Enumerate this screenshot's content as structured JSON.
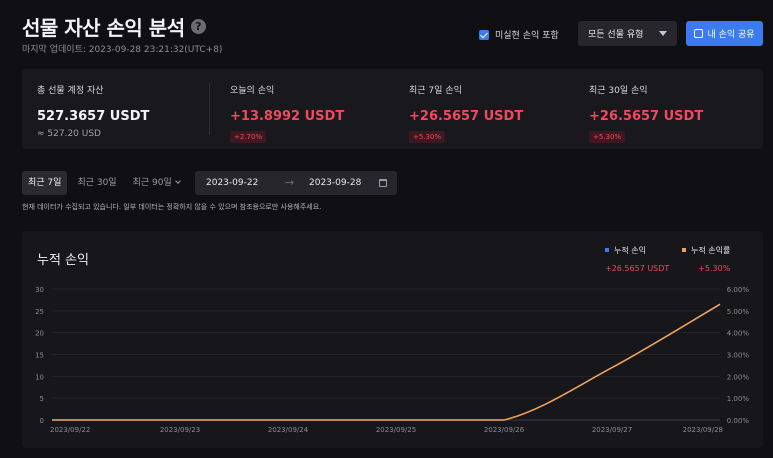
{
  "header": {
    "title": "선물 자산 손익 분석",
    "help_icon": "?",
    "updated": "마지막 업데이트: 2023-09-28 23:21:32(UTC+8)"
  },
  "controls": {
    "unrealized_label": "미실현 손익 포함",
    "unrealized_checked": true,
    "type_select": "모든 선물 유형",
    "share_label": "내 손익 공유"
  },
  "summary": {
    "total": {
      "label": "총 선물 계정 자산",
      "value": "527.3657 USDT",
      "sub": "≈ 527.20 USD"
    },
    "today": {
      "label": "오늘의 손익",
      "value": "+13.8992 USDT",
      "badge": "+2.70%"
    },
    "week": {
      "label": "최근 7일 손익",
      "value": "+26.5657 USDT",
      "badge": "+5.30%"
    },
    "month": {
      "label": "최근 30일 손익",
      "value": "+26.5657 USDT",
      "badge": "+5.30%"
    }
  },
  "range": {
    "tabs": [
      "최근 7일",
      "최근 30일",
      "최근 90일"
    ],
    "active_tab": 0,
    "date_from": "2023-09-22",
    "date_to": "2023-09-28",
    "arrow": "→"
  },
  "notice": "현재 데이터가 수집되고 있습니다. 일부 데이터는 정확하지 않을 수 있으며 참조용으로만 사용해주세요.",
  "chart_data": {
    "type": "line",
    "title": "누적 손익",
    "x": [
      "2023/09/22",
      "2023/09/23",
      "2023/09/24",
      "2023/09/25",
      "2023/09/26",
      "2023/09/27",
      "2023/09/28"
    ],
    "series": [
      {
        "name": "누적 손익",
        "color": "#3a7bef",
        "summary": "+26.5657 USDT",
        "axis": "left",
        "values": [
          0,
          0,
          0,
          0,
          0,
          12,
          26.5657
        ]
      },
      {
        "name": "누적 손익률",
        "color": "#f0a05a",
        "summary": "+5.30%",
        "axis": "right",
        "values": [
          0,
          0,
          0,
          0,
          0,
          2.4,
          5.3
        ]
      }
    ],
    "y_left": {
      "ticks": [
        0,
        5,
        10,
        15,
        20,
        25,
        30
      ],
      "range": [
        0,
        30
      ]
    },
    "y_right": {
      "ticks": [
        "0.00%",
        "1.00%",
        "2.00%",
        "3.00%",
        "4.00%",
        "5.00%",
        "6.00%"
      ],
      "range": [
        0,
        6
      ]
    },
    "grid": true,
    "legend": "top-right"
  }
}
